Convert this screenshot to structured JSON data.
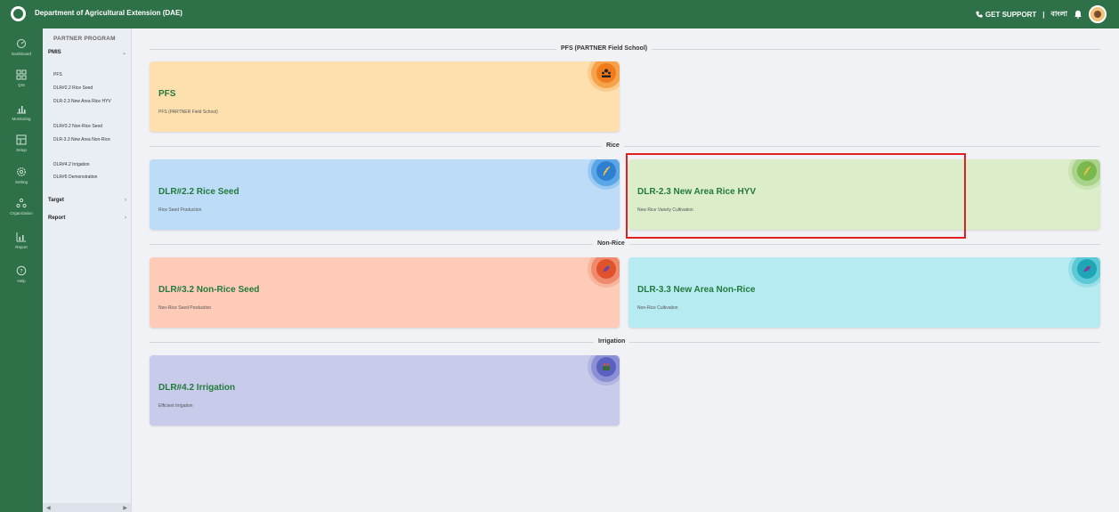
{
  "header": {
    "title": "Department of Agricultural Extension (DAE)",
    "support_label": "GET SUPPORT",
    "separator": "|",
    "language_label": "বাংলা"
  },
  "rail": {
    "items": [
      {
        "label": "Dashboard",
        "icon": "dashboard-icon"
      },
      {
        "label": "QIS",
        "icon": "grid-icon"
      },
      {
        "label": "Monitoring",
        "icon": "chart-icon"
      },
      {
        "label": "Setup",
        "icon": "setup-icon"
      },
      {
        "label": "Setting",
        "icon": "gear-icon"
      },
      {
        "label": "Organization",
        "icon": "organization-icon"
      },
      {
        "label": "Report",
        "icon": "report-icon"
      },
      {
        "label": "Help",
        "icon": "help-icon"
      }
    ]
  },
  "menu": {
    "heading": "PARTNER PROGRAM",
    "groups": [
      {
        "label": "PMIS",
        "chevron": "⌄"
      },
      {
        "label": "Target",
        "chevron": "›"
      },
      {
        "label": "Report",
        "chevron": "›"
      }
    ],
    "pmis_items": [
      "PFS",
      "DLR#2.2 Rice Seed",
      "DLR-2.3 New Area Rice HYV",
      "DLR#3.2 Non-Rice Seed",
      "DLR-3.3 New Area Non-Rice",
      "DLR#4.2 Irrigation",
      "DLR#5 Demonstration"
    ]
  },
  "sections": [
    {
      "label": "PFS (PARTNER Field School)"
    },
    {
      "label": "Rice"
    },
    {
      "label": "Non-Rice"
    },
    {
      "label": "Irrigation"
    }
  ],
  "cards": [
    {
      "title": "PFS",
      "subtitle": "PFS (PARTNER Field School)",
      "icon": "group-icon",
      "bg": "#fde0ae",
      "ring": "#f6a24a",
      "core": "#ef7b1c"
    },
    {
      "title": "DLR#2.2 Rice Seed",
      "subtitle": "Rice Seed Production",
      "icon": "wheat-icon",
      "bg": "#bcdcf7",
      "ring": "#5aa6e6",
      "core": "#2f7fd1"
    },
    {
      "title": "DLR-2.3 New Area Rice HYV",
      "subtitle": "New Rice Variety Cultivation",
      "icon": "wheat-icon",
      "bg": "#dbedc9",
      "ring": "#a9d38a",
      "core": "#7ab84e"
    },
    {
      "title": "DLR#3.2 Non-Rice Seed",
      "subtitle": "Non-Rice Seed Production",
      "icon": "vegetable-icon",
      "bg": "#fdcbb8",
      "ring": "#f08a6c",
      "core": "#e0522c"
    },
    {
      "title": "DLR-3.3 New Area Non-Rice",
      "subtitle": "Non-Rice Cultivation",
      "icon": "vegetable-icon",
      "bg": "#b6ebf2",
      "ring": "#5cc9d6",
      "core": "#1fa5b5"
    },
    {
      "title": "DLR#4.2 Irrigation",
      "subtitle": "Efficient Irrigation",
      "icon": "irrigation-icon",
      "bg": "#c8cbe9",
      "ring": "#8b90d6",
      "core": "#5a60bf"
    }
  ]
}
